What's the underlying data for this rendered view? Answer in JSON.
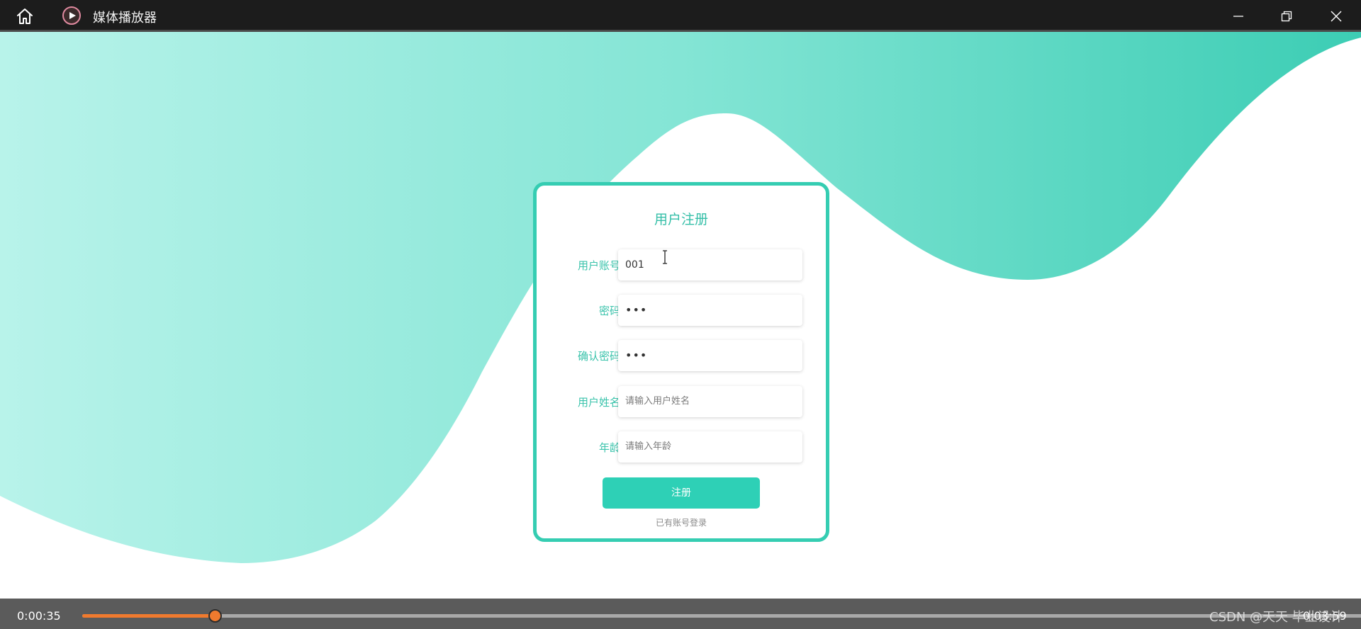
{
  "window": {
    "title": "媒体播放器",
    "controls": {
      "minimize": "minimize-icon",
      "maximize": "restore-icon",
      "close": "close-icon"
    }
  },
  "colors": {
    "accent": "#35cdb2",
    "wave_start": "#b8f3ea",
    "wave_end": "#3ccdb4",
    "progress": "#f07a2e"
  },
  "form": {
    "title": "用户注册",
    "fields": [
      {
        "label": "用户账号:",
        "value": "001",
        "placeholder": ""
      },
      {
        "label": "密码:",
        "value": "•••",
        "placeholder": ""
      },
      {
        "label": "确认密码:",
        "value": "•••",
        "placeholder": ""
      },
      {
        "label": "用户姓名:",
        "value": "",
        "placeholder": "请输入用户姓名"
      },
      {
        "label": "年龄:",
        "value": "",
        "placeholder": "请输入年龄"
      }
    ],
    "submit_label": "注册",
    "login_link": "已有账号登录"
  },
  "player": {
    "current_time": "0:00:35",
    "total_time": "0:03:59",
    "progress": 0.104
  },
  "watermark": "CSDN @天天 毕业设计"
}
